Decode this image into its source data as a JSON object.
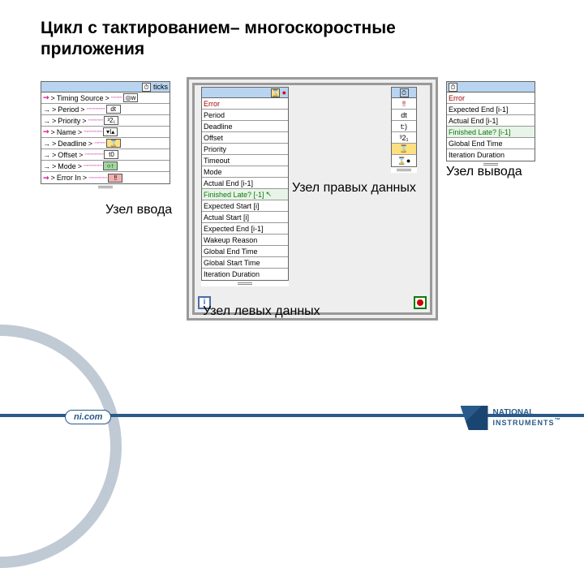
{
  "title_line1": "Цикл с тактированием– многоскоростные",
  "title_line2": "приложения",
  "labels": {
    "input_node": "Узел ввода",
    "output_node": "Узел вывода",
    "left_data": "Узел левых данных",
    "right_data": "Узел правых данных"
  },
  "input_node": {
    "header": "ticks",
    "rows": [
      "Timing Source",
      "Period",
      "Priority",
      "Name",
      "Deadline",
      "Offset",
      "Mode",
      "Error In"
    ]
  },
  "left_data": {
    "rows": [
      "Error",
      "Period",
      "Deadline",
      "Offset",
      "Priority",
      "Timeout",
      "Mode",
      "Actual End [i-1]",
      "Finished Late? [-1]",
      "Expected Start [i]",
      "Actual Start [i]",
      "Expected End [i-1]",
      "Wakeup Reason",
      "Global End Time",
      "Global Start Time",
      "Iteration Duration"
    ],
    "selected_index": 8
  },
  "right_data": {
    "terminals": [
      "‼",
      "dt",
      "t:)",
      "³2₁",
      "⌛",
      "⌛●"
    ]
  },
  "output_node": {
    "rows": [
      "Error",
      "Expected End [i-1]",
      "Actual End [i-1]",
      "Finished Late? [i-1]",
      "Global End Time",
      "Iteration Duration"
    ],
    "selected_index": 3
  },
  "footer": {
    "url": "ni.com",
    "brand1": "NATIONAL",
    "brand2": "INSTRUMENTS",
    "tm": "™"
  }
}
